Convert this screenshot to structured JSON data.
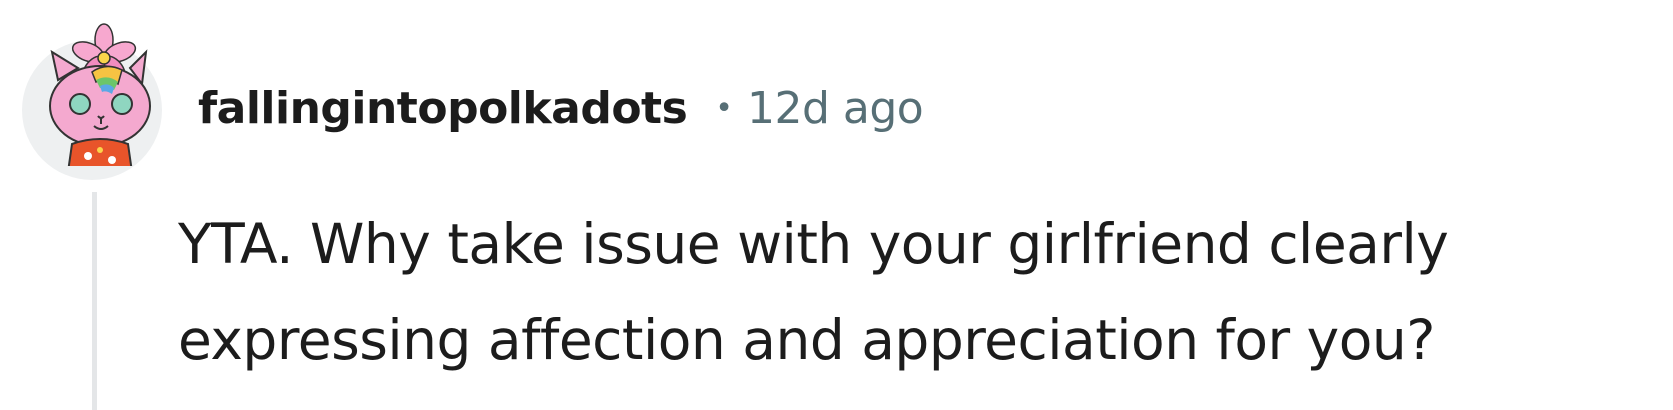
{
  "comment": {
    "author": "fallingintopolkadots",
    "separator": "•",
    "age": "12d ago",
    "body_lines": [
      "YTA. Why take issue with your girlfriend clearly",
      "expressing affection and appreciation for you?"
    ],
    "avatar_icon": "snoo-avatar-icon"
  },
  "colors": {
    "text": "#1c1c1c",
    "muted": "#576f76",
    "thread_line": "#e4e6e8",
    "avatar_bg": "#eef0f1",
    "avatar_skin": "#f4a9cf",
    "flower": "#f27fb3"
  }
}
